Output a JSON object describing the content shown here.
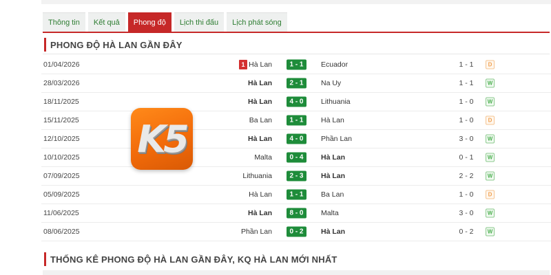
{
  "tabs": [
    {
      "label": "Thông tin",
      "active": false
    },
    {
      "label": "Kết quả",
      "active": false
    },
    {
      "label": "Phong độ",
      "active": true
    },
    {
      "label": "Lịch thi đấu",
      "active": false
    },
    {
      "label": "Lịch phát sóng",
      "active": false
    }
  ],
  "section_title": "PHONG ĐỘ HÀ LAN GẦN ĐÂY",
  "section_title_2": "THỐNG KÊ PHONG ĐỘ HÀ LAN GẦN ĐÂY, KQ HÀ LAN MỚI NHẤT",
  "logo_text": "K5",
  "colors": {
    "accent": "#c62828",
    "score_bg": "#1e8c3a",
    "win": "#4caf50",
    "draw": "#f0a050"
  },
  "matches": [
    {
      "date": "01/04/2026",
      "red_card": "1",
      "home": "Hà Lan",
      "score": "1 - 1",
      "away": "Ecuador",
      "ht": "1 - 1",
      "result": "D",
      "home_bold": false,
      "away_bold": false
    },
    {
      "date": "28/03/2026",
      "red_card": "",
      "home": "Hà Lan",
      "score": "2 - 1",
      "away": "Na Uy",
      "ht": "1 - 1",
      "result": "W",
      "home_bold": true,
      "away_bold": false
    },
    {
      "date": "18/11/2025",
      "red_card": "",
      "home": "Hà Lan",
      "score": "4 - 0",
      "away": "Lithuania",
      "ht": "1 - 0",
      "result": "W",
      "home_bold": true,
      "away_bold": false
    },
    {
      "date": "15/11/2025",
      "red_card": "",
      "home": "Ba Lan",
      "score": "1 - 1",
      "away": "Hà Lan",
      "ht": "1 - 0",
      "result": "D",
      "home_bold": false,
      "away_bold": false
    },
    {
      "date": "12/10/2025",
      "red_card": "",
      "home": "Hà Lan",
      "score": "4 - 0",
      "away": "Phần Lan",
      "ht": "3 - 0",
      "result": "W",
      "home_bold": true,
      "away_bold": false
    },
    {
      "date": "10/10/2025",
      "red_card": "",
      "home": "Malta",
      "score": "0 - 4",
      "away": "Hà Lan",
      "ht": "0 - 1",
      "result": "W",
      "home_bold": false,
      "away_bold": true
    },
    {
      "date": "07/09/2025",
      "red_card": "",
      "home": "Lithuania",
      "score": "2 - 3",
      "away": "Hà Lan",
      "ht": "2 - 2",
      "result": "W",
      "home_bold": false,
      "away_bold": true
    },
    {
      "date": "05/09/2025",
      "red_card": "",
      "home": "Hà Lan",
      "score": "1 - 1",
      "away": "Ba Lan",
      "ht": "1 - 0",
      "result": "D",
      "home_bold": false,
      "away_bold": false
    },
    {
      "date": "11/06/2025",
      "red_card": "",
      "home": "Hà Lan",
      "score": "8 - 0",
      "away": "Malta",
      "ht": "3 - 0",
      "result": "W",
      "home_bold": true,
      "away_bold": false
    },
    {
      "date": "08/06/2025",
      "red_card": "",
      "home": "Phần Lan",
      "score": "0 - 2",
      "away": "Hà Lan",
      "ht": "0 - 2",
      "result": "W",
      "home_bold": false,
      "away_bold": true
    }
  ]
}
